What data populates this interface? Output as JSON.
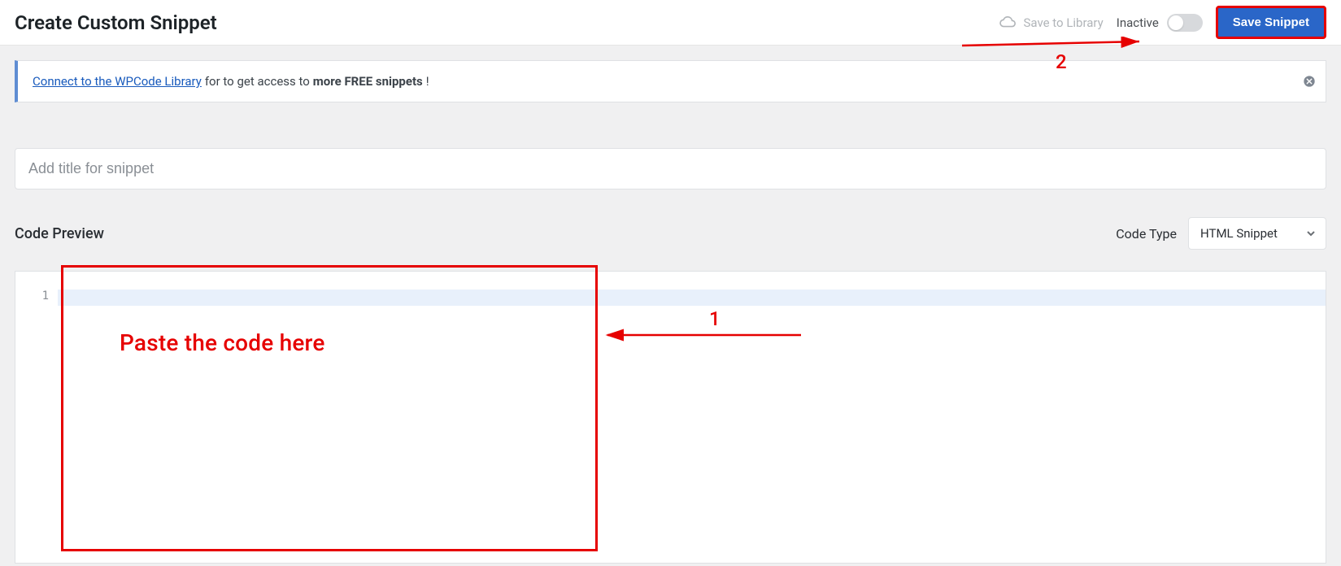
{
  "header": {
    "title": "Create Custom Snippet",
    "save_library_label": "Save to Library",
    "status_label": "Inactive",
    "save_button_label": "Save Snippet"
  },
  "notice": {
    "link_text": "Connect to the WPCode Library",
    "middle_text": " for to get access to ",
    "bold_text": "more FREE snippets",
    "end_text": "!"
  },
  "title_input": {
    "placeholder": "Add title for snippet",
    "value": ""
  },
  "code_preview": {
    "label": "Code Preview",
    "code_type_label": "Code Type",
    "code_type_value": "HTML Snippet",
    "editor": {
      "line_numbers": [
        "1"
      ]
    }
  },
  "annotations": {
    "number_save": "2",
    "number_editor": "1",
    "paste_text": "Paste the code here"
  }
}
